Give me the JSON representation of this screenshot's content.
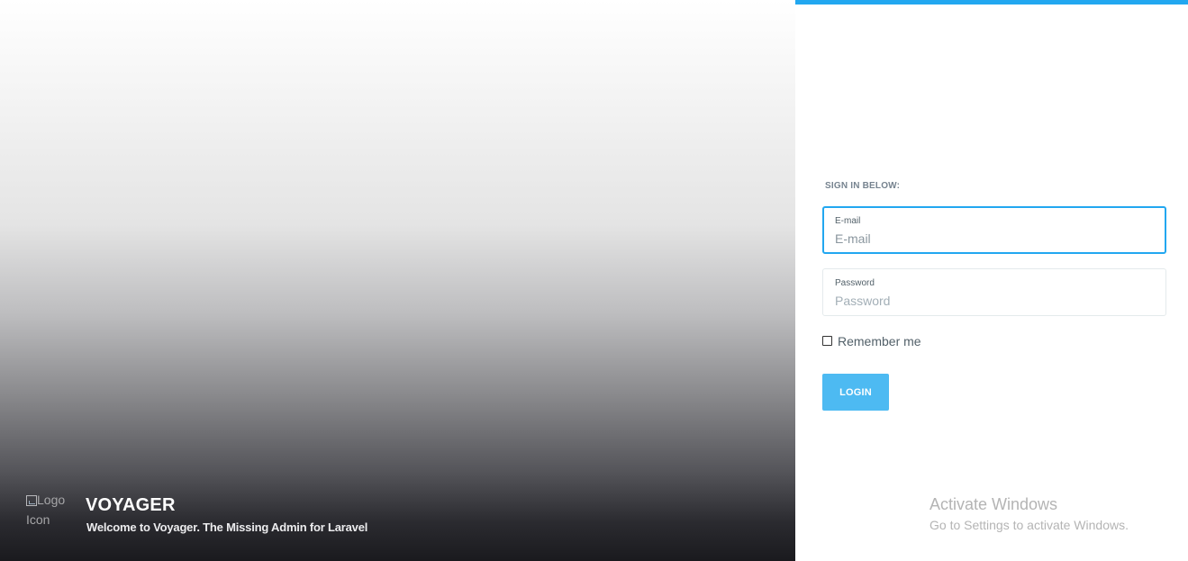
{
  "brand": {
    "logo_alt": "Logo Icon",
    "logo_alt_line1": "Logo",
    "logo_alt_line2": "Icon",
    "title": "VOYAGER",
    "subtitle": "Welcome to Voyager. The Missing Admin for Laravel"
  },
  "form": {
    "heading": "SIGN IN BELOW:",
    "email": {
      "label": "E-mail",
      "placeholder": "E-mail",
      "value": ""
    },
    "password": {
      "label": "Password",
      "placeholder": "Password",
      "value": ""
    },
    "remember": {
      "label": "Remember me",
      "checked": false
    },
    "login_label": "LOGIN"
  },
  "watermark": {
    "title": "Activate Windows",
    "subtitle": "Go to Settings to activate Windows."
  },
  "colors": {
    "accent": "#22a7f0",
    "button": "#4dbaf2",
    "text_muted": "#76838f"
  }
}
